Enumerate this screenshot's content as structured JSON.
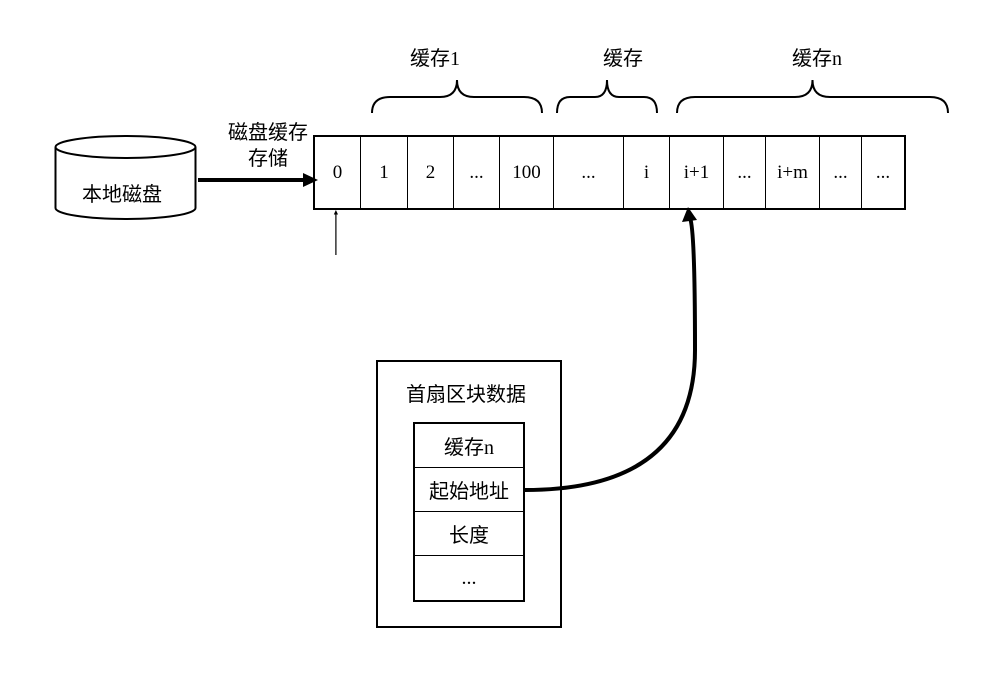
{
  "disk": {
    "local_disk_label": "本地磁盘",
    "disk_cache_storage_label": "磁盘缓存\n存储"
  },
  "cache_labels": {
    "cache1": "缓存1",
    "cache_mid": "缓存",
    "cachen": "缓存n"
  },
  "storage_cells": {
    "c0": "0",
    "c1": "1",
    "c2": "2",
    "dots1": "...",
    "c100": "100",
    "dots2": "...",
    "ci": "i",
    "ci1": "i+1",
    "dots3": "...",
    "cim": "i+m",
    "dots4": "...",
    "dots5": "..."
  },
  "sector_block": {
    "title": "首扇区块数据",
    "rows": {
      "cache_n": "缓存n",
      "start_addr": "起始地址",
      "length": "长度",
      "dots": "..."
    }
  }
}
